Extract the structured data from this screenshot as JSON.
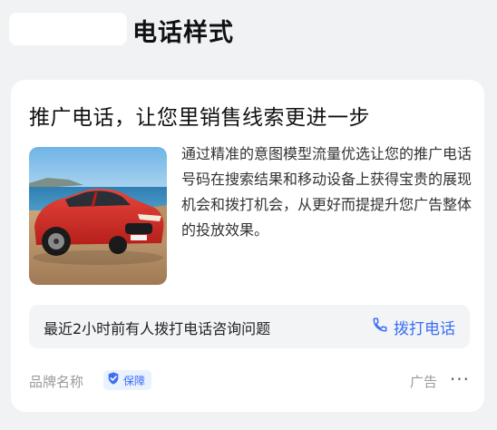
{
  "header": {
    "title": "电话样式"
  },
  "card": {
    "headline": "推广电话，让您里销售线索更进一步",
    "image": {
      "subject": "red-sports-car-photo"
    },
    "description": "通过精准的意图模型流量优选让您的推广电话号码在搜索结果和移动设备上获得宝贵的展现机会和拨打机会，从更好而提提升您广告整体的投放效果。",
    "cta": {
      "text": "最近2小时前有人拨打电话咨询问题",
      "button_label": "拨打电话",
      "button_icon": "phone-icon"
    },
    "footer": {
      "brand": "品牌名称",
      "badge_label": "保障",
      "badge_icon": "shield-check-icon",
      "ad_label": "广告",
      "more": "···"
    }
  },
  "colors": {
    "accent": "#3b6ef5",
    "background": "#f1f2f4",
    "card": "#ffffff",
    "cta_bar": "#f3f4f6"
  }
}
